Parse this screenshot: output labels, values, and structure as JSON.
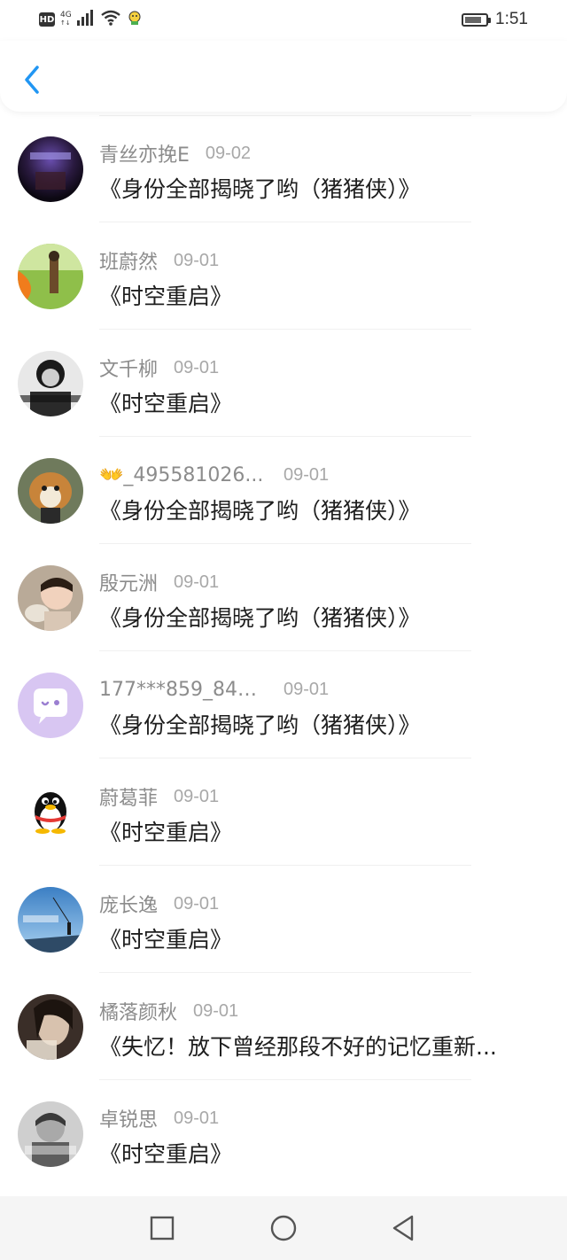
{
  "status_bar": {
    "hd": "HD",
    "net_type": "4G",
    "net_sub": "↑↓",
    "time": "1:51",
    "battery_level": 0.85
  },
  "header": {
    "back_icon": "chevron-left-icon",
    "accent_color": "#2196f3"
  },
  "list": [
    {
      "name": "青丝亦挽E",
      "date": "09-02",
      "title": "《身份全部揭晓了哟（猪猪侠）》",
      "avatar": "dark-night-photo"
    },
    {
      "name": "班蔚然",
      "date": "09-01",
      "title": "《时空重启》",
      "avatar": "girl-in-field-photo"
    },
    {
      "name": "文千柳",
      "date": "09-01",
      "title": "《时空重启》",
      "avatar": "bw-portrait-photo"
    },
    {
      "name": "👐_495581026...",
      "date": "09-01",
      "title": "《身份全部揭晓了哟（猪猪侠）》",
      "avatar": "dog-photo"
    },
    {
      "name": "殷元洲",
      "date": "09-01",
      "title": "《身份全部揭晓了哟（猪猪侠）》",
      "avatar": "child-photo"
    },
    {
      "name": "177***859_847...",
      "date": "09-01",
      "title": "《身份全部揭晓了哟（猪猪侠）》",
      "avatar": "purple-chat-bubble"
    },
    {
      "name": "蔚葛菲",
      "date": "09-01",
      "title": "《时空重启》",
      "avatar": "qq-penguin"
    },
    {
      "name": "庞长逸",
      "date": "09-01",
      "title": "《时空重启》",
      "avatar": "blue-sky-photo"
    },
    {
      "name": "橘落颜秋",
      "date": "09-01",
      "title": "《失忆！放下曾经那段不好的记忆重新...",
      "avatar": "sepia-portrait-photo"
    },
    {
      "name": "卓锐思",
      "date": "09-01",
      "title": "《时空重启》",
      "avatar": "gray-portrait-photo"
    }
  ],
  "nav_bar": {
    "recent_icon": "square-icon",
    "home_icon": "circle-icon",
    "back_icon": "triangle-back-icon"
  }
}
